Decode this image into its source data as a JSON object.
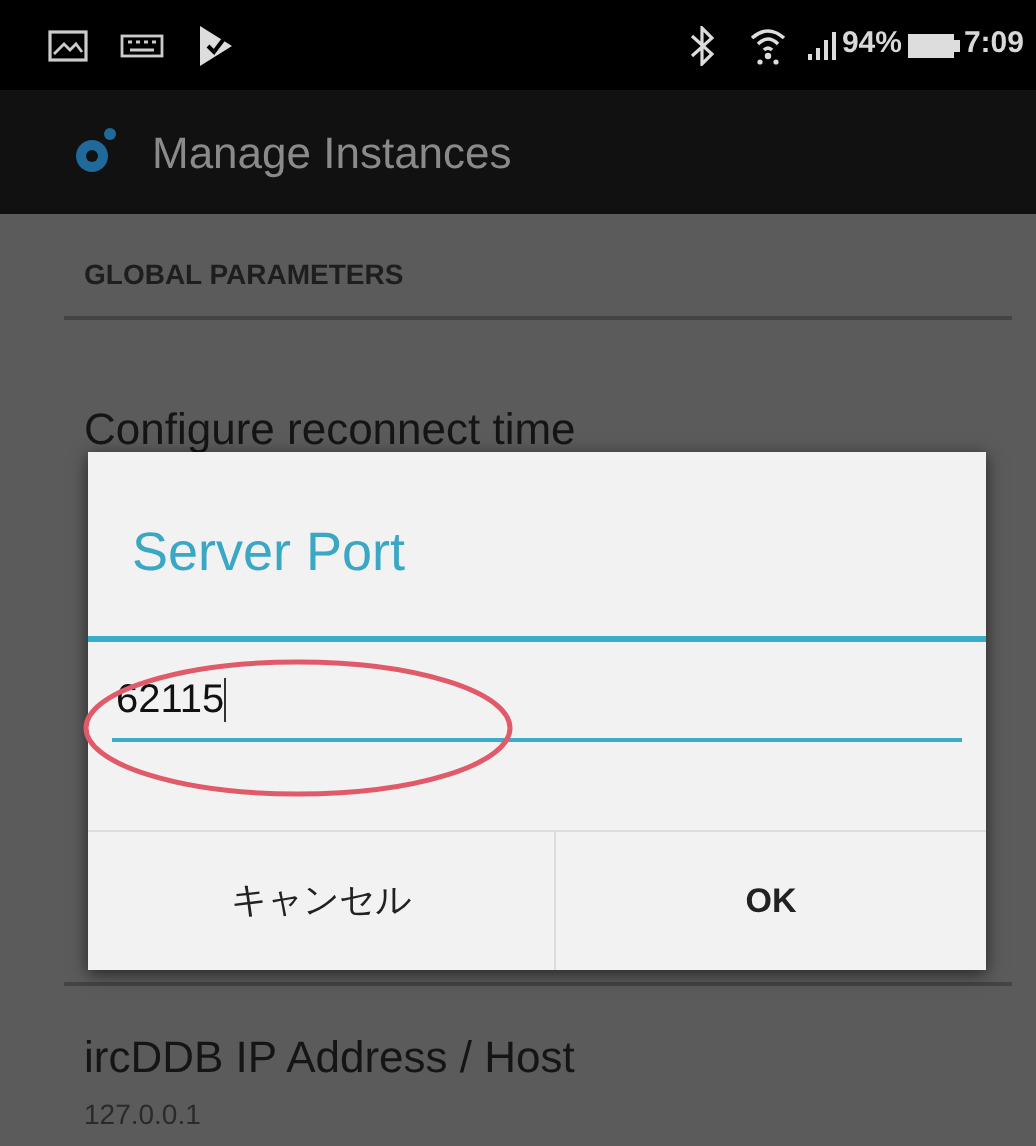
{
  "status_bar": {
    "battery_percent": "94%",
    "time": "7:09"
  },
  "app_bar": {
    "title": "Manage Instances"
  },
  "section_header": "GLOBAL PARAMETERS",
  "preferences": [
    {
      "title": "Configure reconnect time"
    },
    {
      "title": "ircDDB IP Address / Host",
      "summary": "127.0.0.1"
    }
  ],
  "dialog": {
    "title": "Server Port",
    "value": "62115",
    "buttons": [
      "キャンセル",
      "OK"
    ]
  }
}
